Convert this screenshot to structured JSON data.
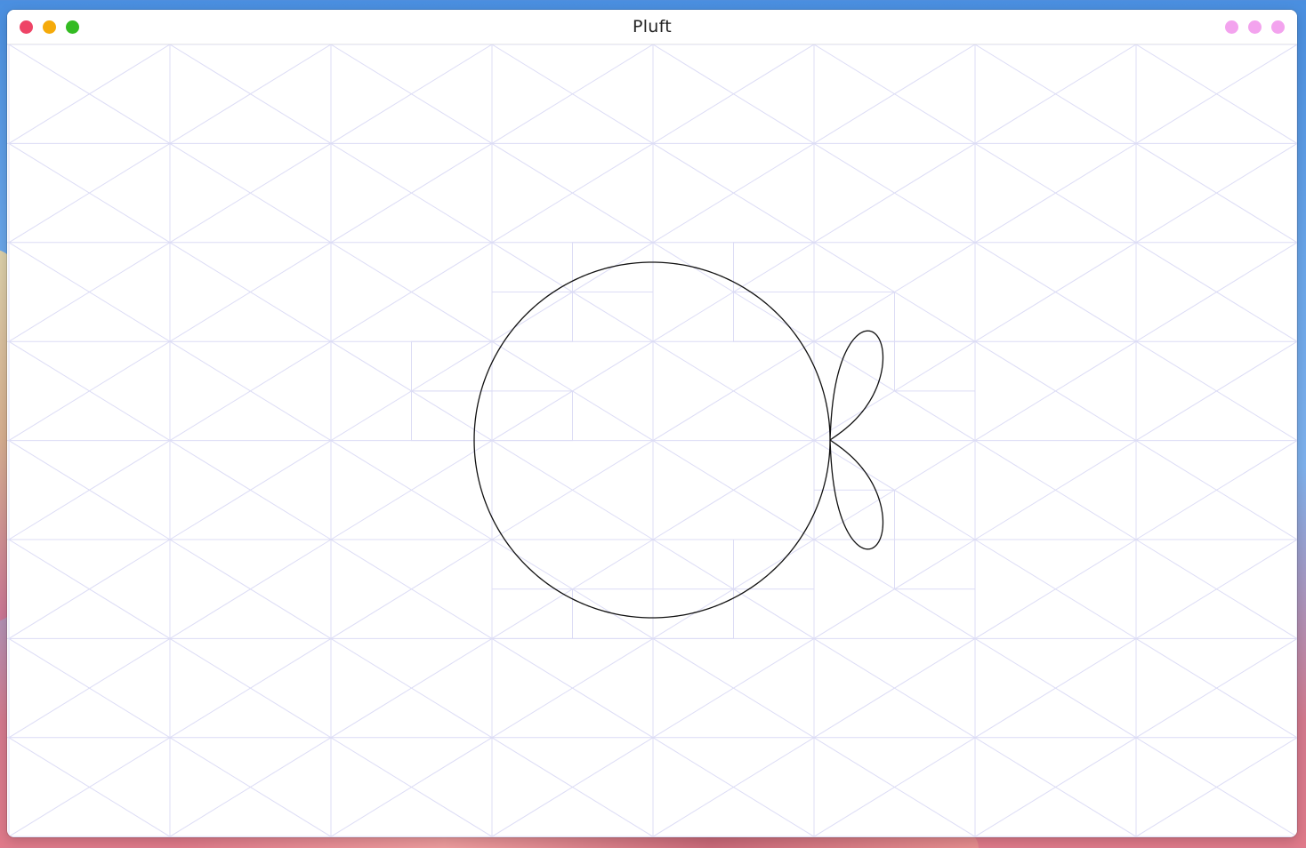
{
  "window": {
    "title": "Pluft"
  },
  "colors": {
    "close": "#ee4466",
    "minimize": "#f5aa0a",
    "maximize": "#33bb22",
    "menu_dots": "#f3a3ee",
    "grid": "#dcdcf5",
    "curve": "#111111"
  },
  "icons": {
    "close": "close-icon",
    "minimize": "minimize-icon",
    "maximize": "maximize-icon",
    "menu": "more-options-icon"
  }
}
